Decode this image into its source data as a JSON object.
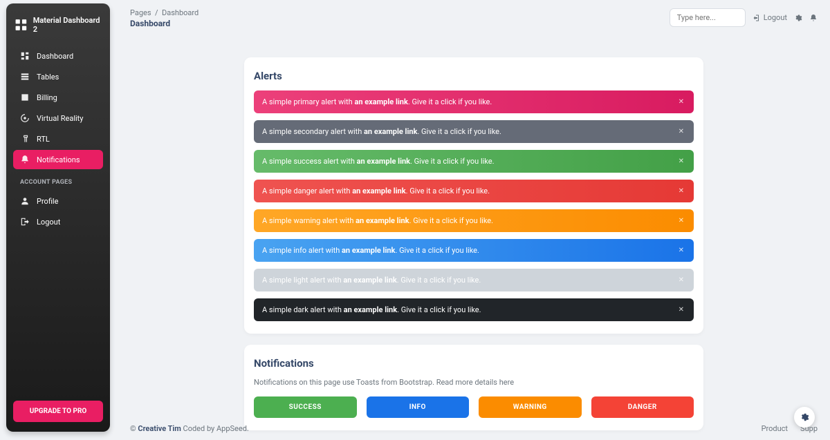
{
  "brand": "Material Dashboard 2",
  "sidebar": {
    "items": [
      {
        "label": "Dashboard"
      },
      {
        "label": "Tables"
      },
      {
        "label": "Billing"
      },
      {
        "label": "Virtual Reality"
      },
      {
        "label": "RTL"
      },
      {
        "label": "Notifications"
      }
    ],
    "account_header": "ACCOUNT PAGES",
    "account": [
      {
        "label": "Profile"
      },
      {
        "label": "Logout"
      }
    ],
    "upgrade": "UPGRADE TO PRO"
  },
  "breadcrumb": {
    "root": "Pages",
    "current": "Dashboard"
  },
  "page_title": "Dashboard",
  "search": {
    "placeholder": "Type here..."
  },
  "toolbar": {
    "logout": "Logout"
  },
  "alerts": {
    "title": "Alerts",
    "link_text": "an example link",
    "tail": ". Give it a click if you like.",
    "items": [
      {
        "prefix": "A simple primary alert with ",
        "color": "primary"
      },
      {
        "prefix": "A simple secondary alert with ",
        "color": "secondary"
      },
      {
        "prefix": "A simple success alert with ",
        "color": "success"
      },
      {
        "prefix": "A simple danger alert with ",
        "color": "danger"
      },
      {
        "prefix": "A simple warning alert with ",
        "color": "warning"
      },
      {
        "prefix": "A simple info alert with ",
        "color": "info"
      },
      {
        "prefix": "A simple light alert with ",
        "color": "light"
      },
      {
        "prefix": "A simple dark alert with ",
        "color": "dark"
      }
    ]
  },
  "notifications": {
    "title": "Notifications",
    "subtitle_prefix": "Notifications on this page use Toasts from Bootstrap. Read more details ",
    "subtitle_link": "here",
    "buttons": [
      "SUCCESS",
      "INFO",
      "WARNING",
      "DANGER"
    ]
  },
  "footer": {
    "copyright_prefix": "© ",
    "brand": "Creative Tim",
    "coded": " Coded by AppSeed.",
    "links": [
      "Product",
      "Supp"
    ]
  },
  "colors": {
    "pink": "#e91e63",
    "green": "#4caf50",
    "red": "#f44336",
    "orange": "#fb8c00",
    "blue": "#1a73e8",
    "light": "#ced4da",
    "dark": "#212529"
  }
}
